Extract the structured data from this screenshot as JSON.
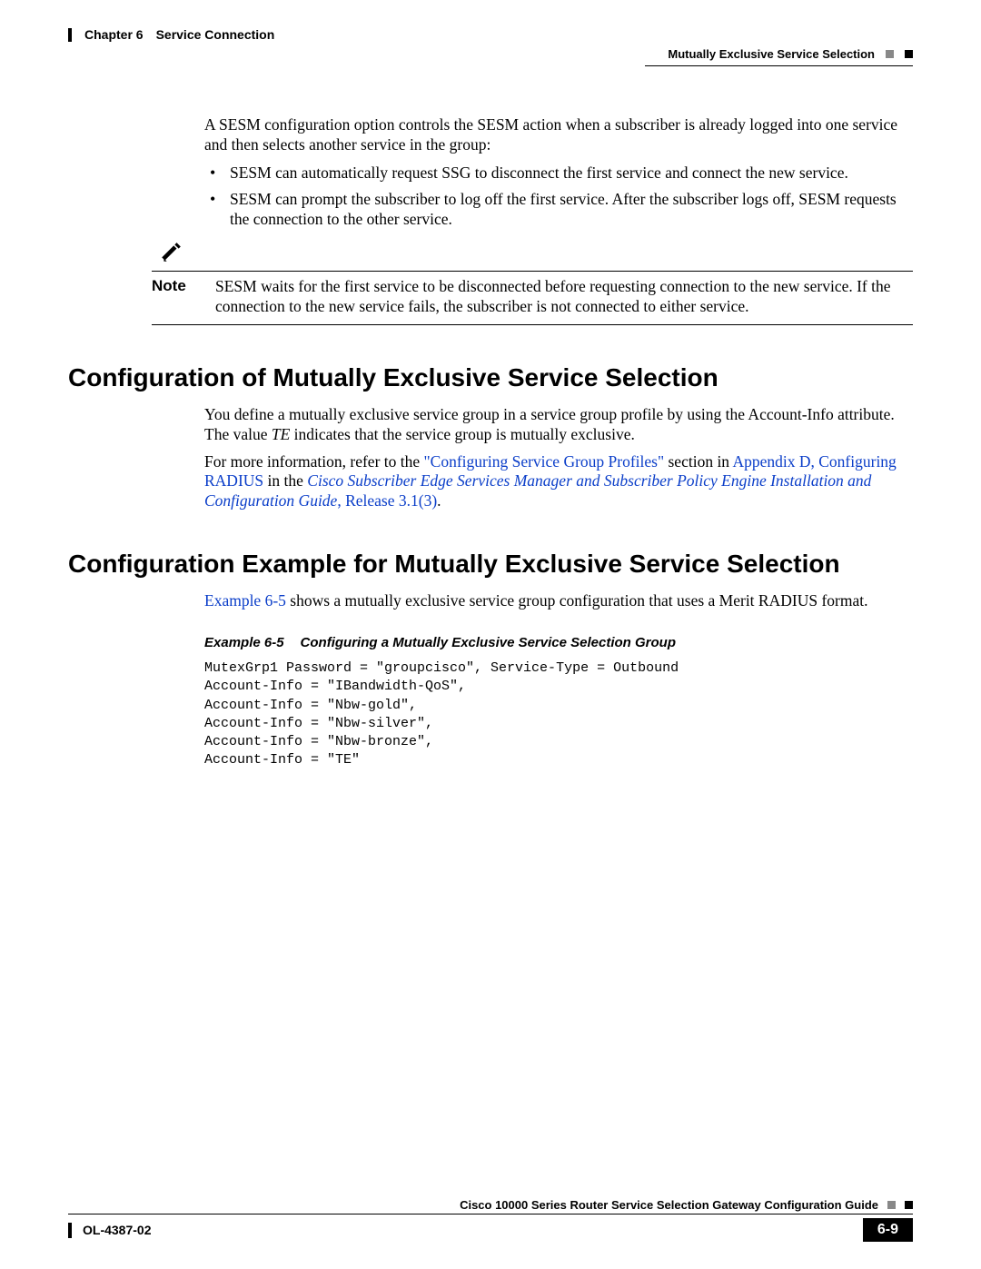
{
  "header": {
    "chapter_label": "Chapter 6",
    "chapter_title": "Service Connection",
    "section_title": "Mutually Exclusive Service Selection"
  },
  "intro": {
    "p1": "A SESM configuration option controls the SESM action when a subscriber is already logged into one service and then selects another service in the group:",
    "bullets": [
      "SESM can automatically request SSG to disconnect the first service and connect the new service.",
      "SESM can prompt the subscriber to log off the first service. After the subscriber logs off, SESM requests the connection to the other service."
    ]
  },
  "note": {
    "label": "Note",
    "text": "SESM waits for the first service to be disconnected before requesting connection to the new service. If the connection to the new service fails, the subscriber is not connected to either service."
  },
  "section1": {
    "heading": "Configuration of Mutually Exclusive Service Selection",
    "p1a": "You define a mutually exclusive service group in a service group profile by using the Account-Info attribute. The value ",
    "p1_em": "TE",
    "p1b": " indicates that the service group is mutually exclusive.",
    "p2a": "For more information, refer to the ",
    "link1": "\"Configuring Service Group Profiles\"",
    "p2b": " section in ",
    "link2": "Appendix D, Configuring RADIUS",
    "p2c": " in the ",
    "link3_em": "Cisco Subscriber Edge Services Manager and Subscriber Policy Engine Installation and Configuration Guide",
    "link3_tail": ", Release 3.1(3)",
    "p2d": "."
  },
  "section2": {
    "heading": "Configuration Example for Mutually Exclusive Service Selection",
    "p1a_link": "Example 6-5",
    "p1b": " shows a mutually exclusive service group configuration that uses a Merit RADIUS format.",
    "example_num": "Example 6-5",
    "example_title": "Configuring a Mutually Exclusive Service Selection Group",
    "code": "MutexGrp1 Password = \"groupcisco\", Service-Type = Outbound\nAccount-Info = \"IBandwidth-QoS\",\nAccount-Info = \"Nbw-gold\",\nAccount-Info = \"Nbw-silver\",\nAccount-Info = \"Nbw-bronze\",\nAccount-Info = \"TE\""
  },
  "footer": {
    "book_title": "Cisco 10000 Series Router Service Selection Gateway Configuration Guide",
    "doc_id": "OL-4387-02",
    "page_num": "6-9"
  }
}
